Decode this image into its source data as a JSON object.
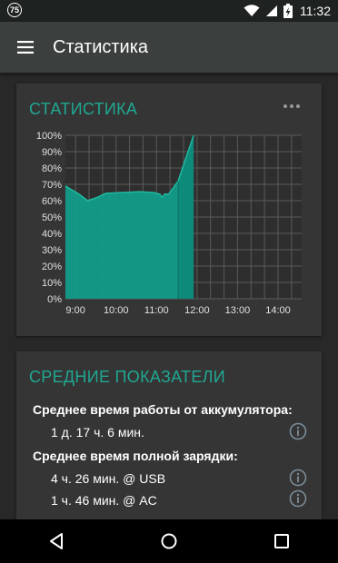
{
  "status_bar": {
    "notification_badge": "75",
    "time": "11:32",
    "icons": [
      "notification-badge-icon",
      "wifi-icon",
      "cell-signal-icon",
      "battery-charging-icon"
    ]
  },
  "app_bar": {
    "title": "Статистика",
    "menu_icon": "hamburger-menu-icon"
  },
  "stats_card": {
    "title": "СТАТИСТИКА",
    "more_icon": "more-horizontal-icon"
  },
  "chart_data": {
    "type": "area",
    "title": "",
    "y_ticks": [
      "100%",
      "90%",
      "80%",
      "70%",
      "60%",
      "50%",
      "40%",
      "30%",
      "20%",
      "10%",
      "0%"
    ],
    "x_ticks": [
      "9:00",
      "10:00",
      "11:00",
      "12:00",
      "13:00",
      "14:00"
    ],
    "ylim": [
      0,
      100
    ],
    "xlim": [
      "8:45",
      "14:35"
    ],
    "grid": true,
    "series": [
      {
        "color": "#139c89",
        "points": [
          {
            "x": "8:45",
            "y": 69
          },
          {
            "x": "9:05",
            "y": 64
          },
          {
            "x": "9:18",
            "y": 60
          },
          {
            "x": "9:32",
            "y": 62
          },
          {
            "x": "9:45",
            "y": 64.5
          },
          {
            "x": "10:10",
            "y": 65
          },
          {
            "x": "10:35",
            "y": 65.5
          },
          {
            "x": "10:55",
            "y": 65
          },
          {
            "x": "11:05",
            "y": 64
          },
          {
            "x": "11:08",
            "y": 62
          },
          {
            "x": "11:12",
            "y": 64
          },
          {
            "x": "11:18",
            "y": 64
          },
          {
            "x": "11:32",
            "y": 72
          },
          {
            "x": "11:45",
            "y": 88
          },
          {
            "x": "11:55",
            "y": 100
          }
        ]
      }
    ],
    "highlight_region": {
      "from": "11:32",
      "to": "11:55",
      "color": "#0e8a7a"
    }
  },
  "avg_card": {
    "title": "СРЕДНИЕ ПОКАЗАТЕЛИ",
    "battery_label": "Среднее время работы от аккумулятора:",
    "battery_value": "1 д. 17 ч. 6 мин.",
    "charge_label": "Среднее время полной зарядки:",
    "usb_value": "4 ч. 26 мин. @ USB",
    "ac_value": "1 ч. 46 мин. @ AC",
    "info_icon": "info-circle-icon"
  },
  "nav_bar": {
    "icons": [
      "back-icon",
      "home-icon",
      "recents-icon"
    ]
  },
  "colors": {
    "accent": "#1fa892",
    "chart_fill": "#139c89",
    "card_bg": "#353535",
    "app_bar_bg": "#3b3f3d",
    "page_bg": "#282828"
  }
}
